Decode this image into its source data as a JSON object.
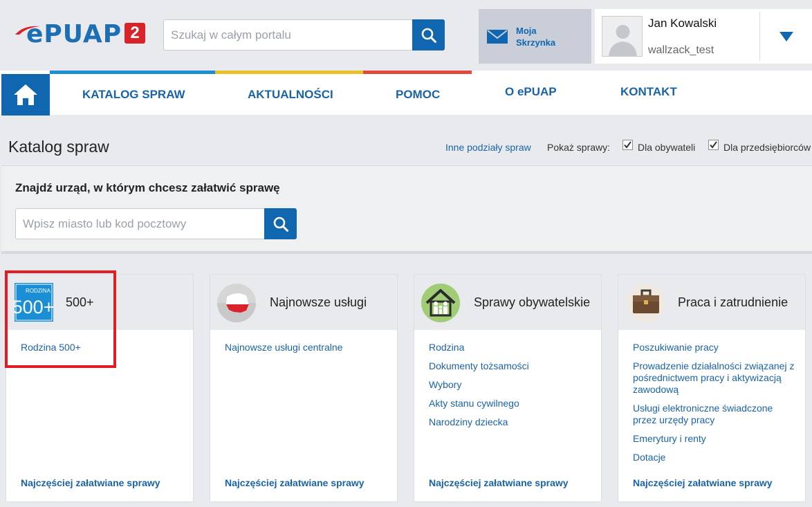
{
  "header": {
    "logo_text": "ePUAP",
    "logo_badge": "2",
    "search": {
      "placeholder": "Szukaj w całym portalu"
    },
    "inbox": {
      "label": "Moja Skrzynka"
    },
    "user": {
      "name": "Jan Kowalski",
      "login": "wallzack_test"
    }
  },
  "nav": {
    "items": [
      {
        "label": "KATALOG SPRAW"
      },
      {
        "label": "AKTUALNOŚCI"
      },
      {
        "label": "POMOC"
      },
      {
        "label": "O ePUAP"
      },
      {
        "label": "KONTAKT"
      }
    ],
    "stripe_colors": [
      "#1a8fd6",
      "#e9c22a",
      "#e0493e"
    ]
  },
  "page": {
    "title": "Katalog spraw",
    "other_divisions_link": "Inne podziały spraw",
    "show_label": "Pokaż sprawy:",
    "filters": [
      {
        "label": "Dla obywateli",
        "checked": true
      },
      {
        "label": "Dla przedsiębiorców",
        "checked": true
      }
    ]
  },
  "finder": {
    "title": "Znajdź urząd, w którym chcesz załatwić sprawę",
    "placeholder": "Wpisz miasto lub kod pocztowy"
  },
  "cards": [
    {
      "title": "500+",
      "icon": "rodzina-500-icon",
      "icon_text_small": "RODZINA",
      "icon_text_big": "500+",
      "links": [
        "Rodzina 500+"
      ],
      "footer": "Najczęściej załatwiane sprawy"
    },
    {
      "title": "Najnowsze usługi",
      "icon": "poland-map-icon",
      "links": [
        "Najnowsze usługi centralne"
      ],
      "footer": "Najczęściej załatwiane sprawy"
    },
    {
      "title": "Sprawy obywatelskie",
      "icon": "family-house-icon",
      "links": [
        "Rodzina",
        "Dokumenty tożsamości",
        "Wybory",
        "Akty stanu cywilnego",
        "Narodziny dziecka"
      ],
      "footer": "Najczęściej załatwiane sprawy"
    },
    {
      "title": "Praca i zatrudnienie",
      "icon": "briefcase-icon",
      "links": [
        "Poszukiwanie pracy",
        "Prowadzenie działalności związanej z pośrednictwem pracy i aktywizacją zawodową",
        "Usługi elektroniczne świadczone przez urzędy pracy",
        "Emerytury i renty",
        "Dotacje"
      ],
      "footer": "Najczęściej załatwiane sprawy"
    }
  ],
  "colors": {
    "primary": "#1067b0",
    "link": "#1a63a8",
    "highlight": "#e01d25",
    "badge": "#d8232a"
  }
}
